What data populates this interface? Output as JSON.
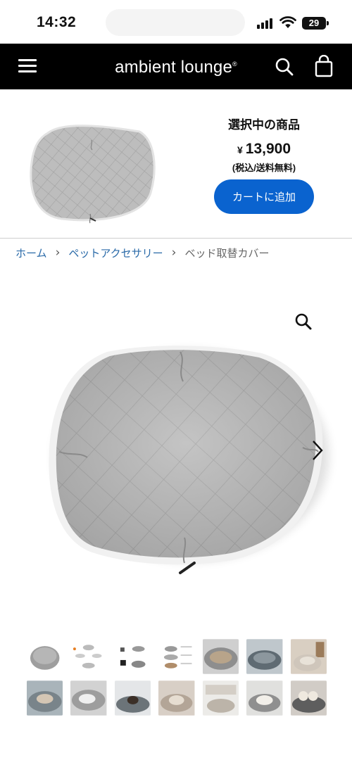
{
  "status_bar": {
    "time": "14:32",
    "battery": "29"
  },
  "header": {
    "brand": "ambient lounge",
    "brand_mark": "®"
  },
  "selected_product": {
    "label": "選択中の商品",
    "currency": "¥",
    "price": "13,900",
    "tax_note": "(税込/送料無料)",
    "cart_button": "カートに追加"
  },
  "breadcrumb": {
    "home": "ホーム",
    "category": "ペットアクセサリー",
    "current": "ベッド取替カバー",
    "separator": "›"
  },
  "colors": {
    "header_bg": "#000000",
    "cart_button": "#0a63cf",
    "breadcrumb_link": "#2a6aa8",
    "product_fabric": "#b9b9b9"
  },
  "gallery": {
    "thumbnail_count": 14,
    "rows": 2,
    "per_row": 7
  }
}
